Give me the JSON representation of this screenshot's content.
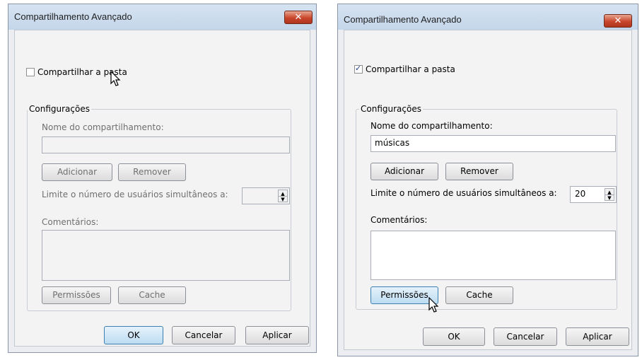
{
  "dialog_left": {
    "title": "Compartilhamento Avançado",
    "close": "✕",
    "share_checkbox": {
      "label": "Compartilhar a pasta",
      "checked": false
    },
    "settings_group": {
      "legend": "Configurações",
      "share_name_label": "Nome do compartilhamento:",
      "share_name_value": "",
      "add_button": "Adicionar",
      "remove_button": "Remover",
      "limit_label": "Limite o número de usuários simultâneos a:",
      "limit_value": "",
      "comments_label": "Comentários:",
      "comments_value": "",
      "permissions_button": "Permissões",
      "cache_button": "Cache"
    },
    "ok_button": "OK",
    "cancel_button": "Cancelar",
    "apply_button": "Aplicar"
  },
  "dialog_right": {
    "title": "Compartilhamento Avançado",
    "close": "✕",
    "share_checkbox": {
      "label": "Compartilhar a pasta",
      "checked": true
    },
    "settings_group": {
      "legend": "Configurações",
      "share_name_label": "Nome do compartilhamento:",
      "share_name_value": "músicas",
      "add_button": "Adicionar",
      "remove_button": "Remover",
      "limit_label": "Limite o número de usuários simultâneos a:",
      "limit_value": "20",
      "comments_label": "Comentários:",
      "comments_value": "",
      "permissions_button": "Permissões",
      "cache_button": "Cache"
    },
    "ok_button": "OK",
    "cancel_button": "Cancelar",
    "apply_button": "Aplicar"
  }
}
